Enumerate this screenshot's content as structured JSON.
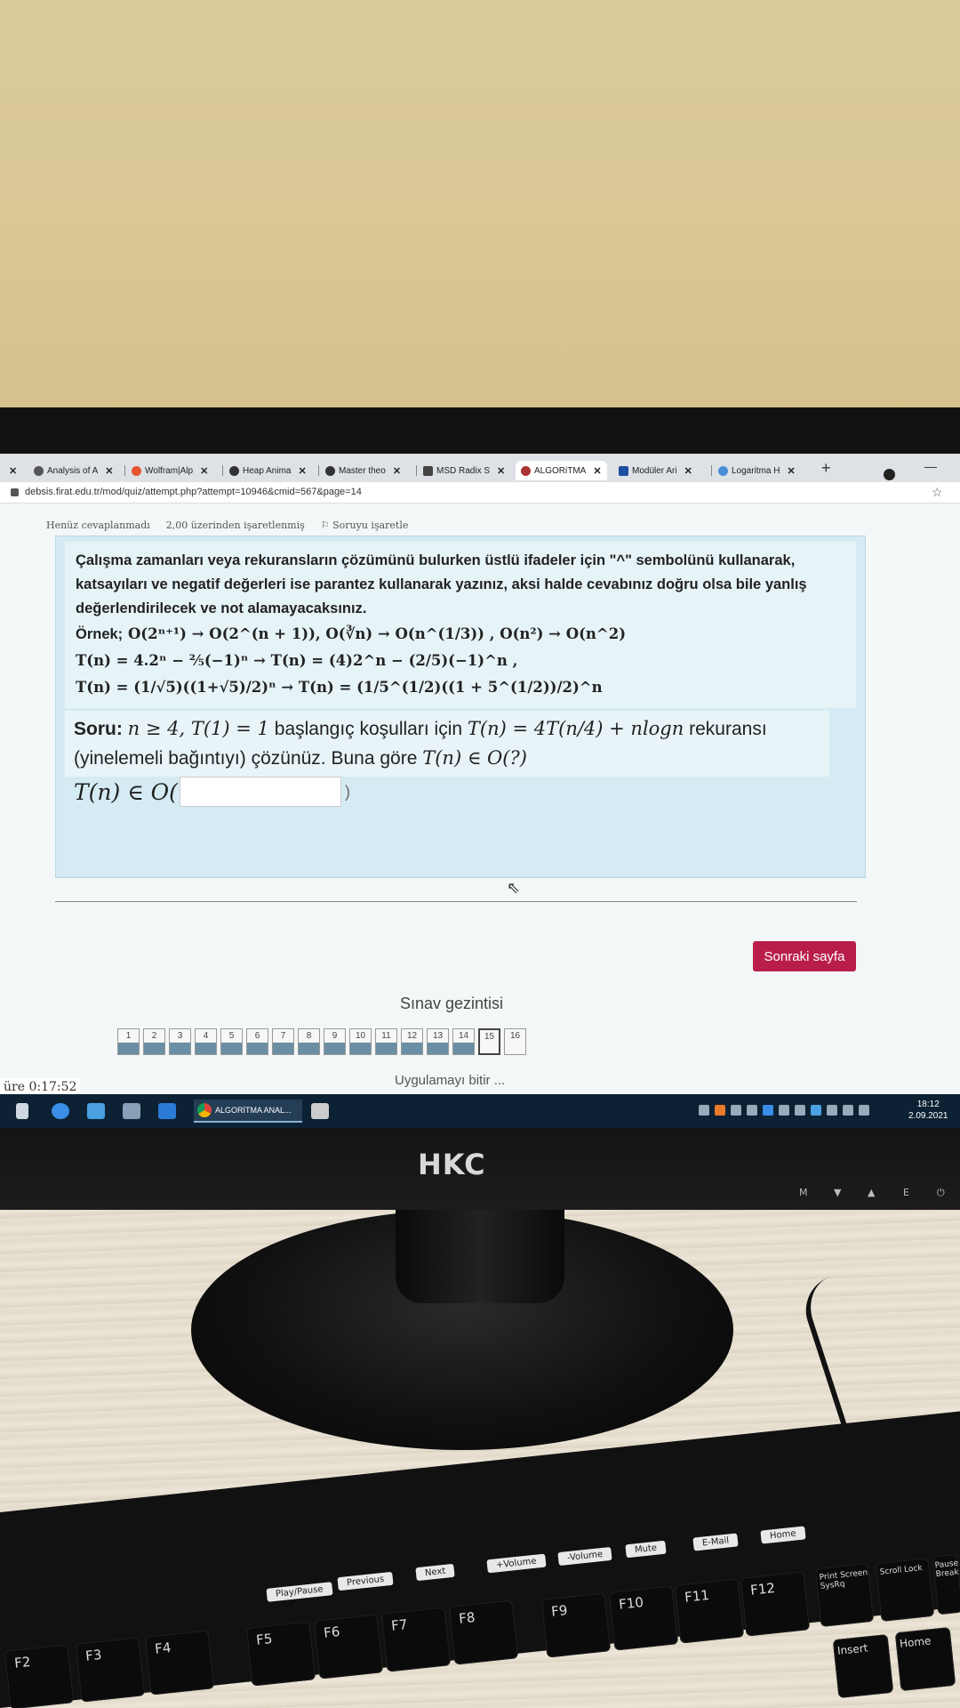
{
  "browser": {
    "tabs": [
      {
        "label": "Analysis of A",
        "color": "#555"
      },
      {
        "label": "Wolfram|Alp",
        "color": "#e8542e"
      },
      {
        "label": "Heap Anima",
        "color": "#333"
      },
      {
        "label": "Master theo",
        "color": "#333"
      },
      {
        "label": "MSD Radix S",
        "color": "#444"
      },
      {
        "label": "ALGORiTMA",
        "color": "#a33",
        "active": true
      },
      {
        "label": "Modüler Ari",
        "color": "#1a4ea0"
      },
      {
        "label": "Logaritma H",
        "color": "#4a8ed8"
      }
    ],
    "new_tab": "+",
    "url": "debsis.firat.edu.tr/mod/quiz/attempt.php?attempt=10946&cmid=567&page=14"
  },
  "quiz": {
    "status": "Henüz cevaplanmadı",
    "points": "2,00 üzerinden işaretlenmiş",
    "flag": "Soruyu işaretle",
    "info_text": "Çalışma zamanları veya rekuransların çözümünü bulurken üstlü ifadeler için \"^\" sembolünü kullanarak, katsayıları ve negatif değerleri ise parantez kullanarak yazınız, aksi halde cevabınız doğru olsa bile yanlış değerlendirilecek ve not alamayacaksınız.",
    "example_label": "Örnek;",
    "example1": "O(2ⁿ⁺¹) → O(2^(n + 1)),  O(∛n) → O(n^(1/3)) , O(n²) → O(n^2)",
    "example2": "T(n) = 4.2ⁿ − ⅖(−1)ⁿ → T(n) = (4)2^n − (2/5)(−1)^n ,",
    "example3": "T(n) = (1/√5)((1+√5)/2)ⁿ → T(n) = (1/5^(1/2)((1 + 5^(1/2))/2)^n",
    "question_label": "Soru:",
    "question_math1": "n ≥ 4, T(1) = 1",
    "question_text1": "başlangıç koşulları için",
    "question_math2": "T(n) = 4T(n/4) + nlogn",
    "question_text2": "rekuransı (yinelemeli bağıntıyı) çözünüz.  Buna göre",
    "question_math3": "T(n) ∈ O(?)",
    "answer_prefix": "T(n) ∈ O(",
    "answer_value": "",
    "answer_suffix": ")",
    "next_button": "Sonraki sayfa"
  },
  "navigation": {
    "title": "Sınav gezintisi",
    "pages": [
      "1",
      "2",
      "3",
      "4",
      "5",
      "6",
      "7",
      "8",
      "9",
      "10",
      "11",
      "12",
      "13",
      "14",
      "15",
      "16"
    ],
    "answered_count": 14,
    "current_page": "15",
    "finish": "Uygulamayı bitir ...",
    "timer": "üre 0:17:52"
  },
  "taskbar": {
    "active_app": "ALGORİTMA ANAL...",
    "time": "18:12",
    "date": "2.09.2021"
  },
  "hardware": {
    "brand": "HKC",
    "monitor_buttons": [
      "M",
      "▼",
      "▲",
      "E",
      "⏻"
    ],
    "media_keys": [
      "Play/Pause",
      "Previous",
      "Next",
      "+Volume",
      "-Volume",
      "Mute",
      "E-Mail",
      "Home"
    ],
    "keys": [
      "F2",
      "F3",
      "F4",
      "F5",
      "F6",
      "F7",
      "F8",
      "F9",
      "F10",
      "F11",
      "F12",
      "Print Screen SysRq",
      "Scroll Lock",
      "Pause Break",
      "Insert",
      "Home"
    ]
  }
}
